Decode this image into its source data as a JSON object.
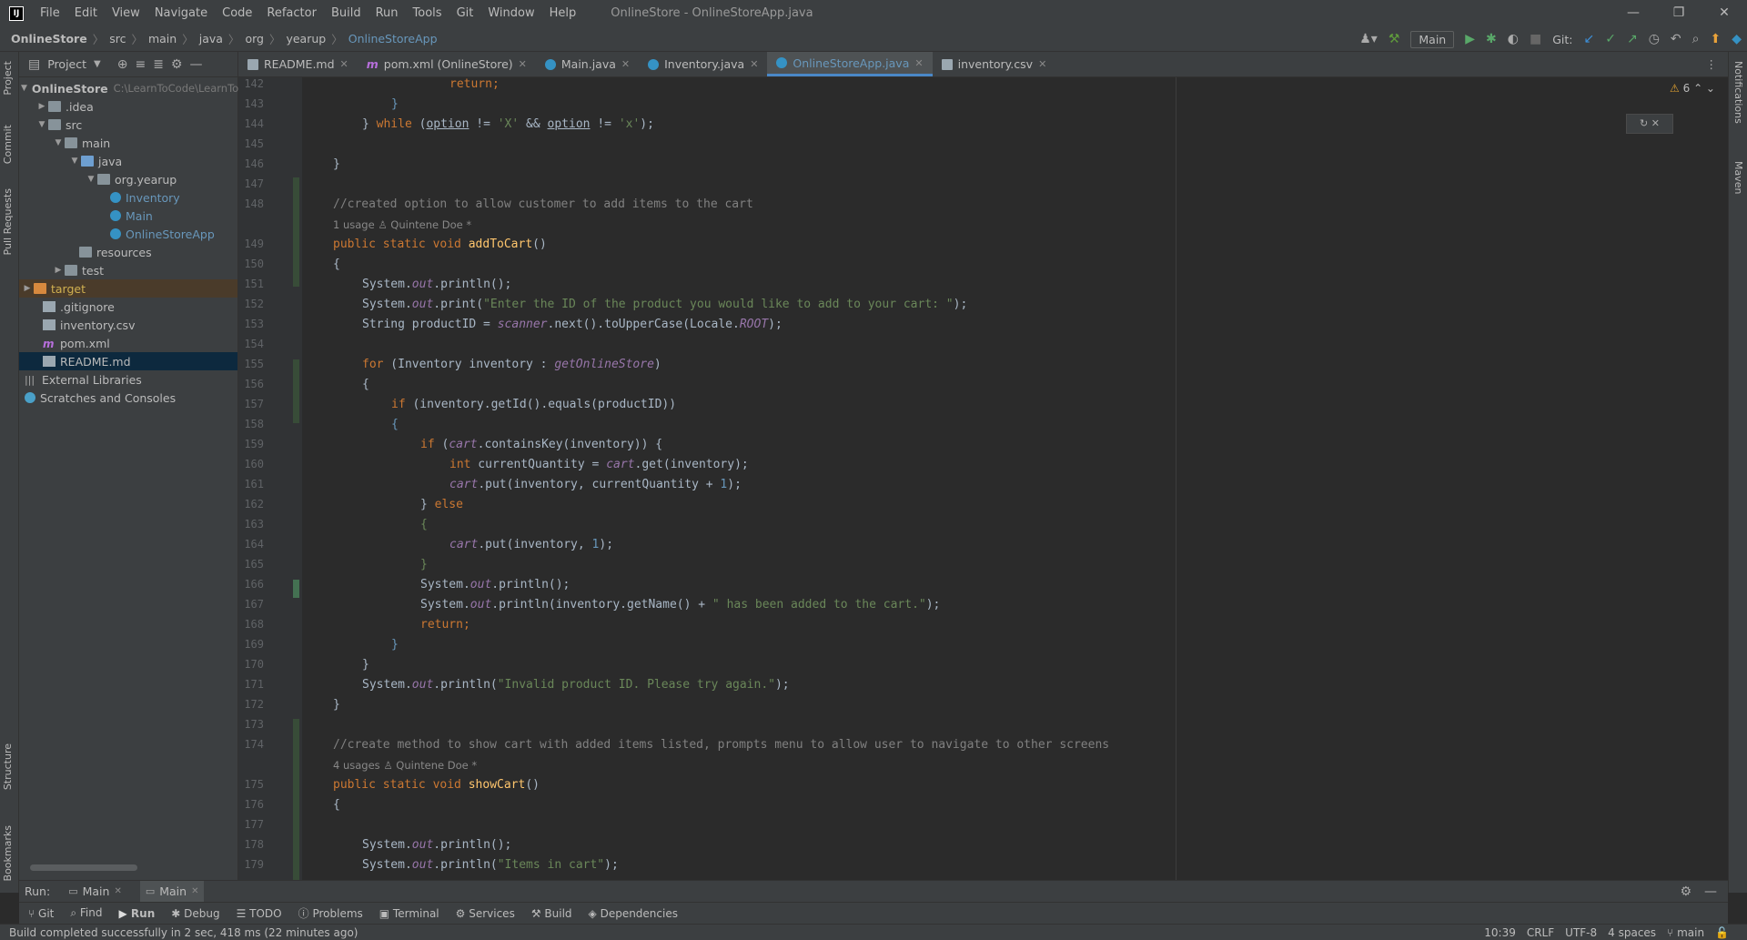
{
  "window": {
    "menu": [
      "File",
      "Edit",
      "View",
      "Navigate",
      "Code",
      "Refactor",
      "Build",
      "Run",
      "Tools",
      "Git",
      "Window",
      "Help"
    ],
    "title": "OnlineStore - OnlineStoreApp.java",
    "controls": [
      "—",
      "❐",
      "✕"
    ]
  },
  "breadcrumb": [
    "OnlineStore",
    "src",
    "main",
    "java",
    "org",
    "yearup",
    "OnlineStoreApp"
  ],
  "toolbar": {
    "run_config": "Main",
    "git_label": "Git:"
  },
  "left_stripe": [
    "Project",
    "Commit",
    "Pull Requests",
    "Structure",
    "Bookmarks"
  ],
  "right_stripe": [
    "Notifications",
    "Maven"
  ],
  "project": {
    "title": "Project",
    "root": {
      "name": "OnlineStore",
      "path": "C:\\LearnToCode\\LearnToC"
    },
    "items": [
      {
        "label": ".idea"
      },
      {
        "label": "src"
      },
      {
        "label": "main"
      },
      {
        "label": "java"
      },
      {
        "label": "org.yearup"
      },
      {
        "label": "Inventory"
      },
      {
        "label": "Main"
      },
      {
        "label": "OnlineStoreApp"
      },
      {
        "label": "resources"
      },
      {
        "label": "test"
      },
      {
        "label": "target"
      },
      {
        "label": ".gitignore"
      },
      {
        "label": "inventory.csv"
      },
      {
        "label": "pom.xml"
      },
      {
        "label": "README.md"
      },
      {
        "label": "External Libraries"
      },
      {
        "label": "Scratches and Consoles"
      }
    ]
  },
  "tabs": [
    {
      "label": "README.md"
    },
    {
      "label": "pom.xml (OnlineStore)"
    },
    {
      "label": "Main.java"
    },
    {
      "label": "Inventory.java"
    },
    {
      "label": "OnlineStoreApp.java"
    },
    {
      "label": "inventory.csv"
    }
  ],
  "editor": {
    "warnings": "6",
    "line_numbers": [
      "142",
      "143",
      "144",
      "145",
      "146",
      "147",
      "148",
      "149",
      "150",
      "151",
      "152",
      "153",
      "154",
      "155",
      "156",
      "157",
      "158",
      "159",
      "160",
      "161",
      "162",
      "163",
      "164",
      "165",
      "166",
      "167",
      "168",
      "169",
      "170",
      "171",
      "172",
      "173",
      "174",
      "175",
      "176",
      "177",
      "178",
      "179"
    ],
    "hint1": "1 usage   ♙ Quintene Doe *",
    "hint2": "4 usages   ♙ Quintene Doe *",
    "code": {
      "l142": "return;",
      "l144a": "} ",
      "l144kw": "while",
      "l144b": " (",
      "l144c": "option",
      "l144d": " != ",
      "l144e": "'X'",
      "l144f": " && ",
      "l144g": "option",
      "l144h": " != ",
      "l144i": "'x'",
      "l144j": ");",
      "l148": "//created option to allow customer to add items to the cart",
      "l149kw": "public static void ",
      "l149fn": "addToCart",
      "l149b": "()",
      "l152a": "System.",
      "l152b": "out",
      "l152c": ".print(",
      "l152d": "\"Enter the ID of the product you would like to add to your cart: \"",
      "l152e": ");",
      "l153a": "String productID = ",
      "l153b": "scanner",
      "l153c": ".next().toUpperCase(Locale.",
      "l153d": "ROOT",
      "l153e": ");",
      "l155kw": "for",
      "l155a": " (Inventory inventory : ",
      "l155b": "getOnlineStore",
      "l155c": ")",
      "l157kw": "if",
      "l157a": " (inventory.getId().equals(productID))",
      "l159kw": "if",
      "l159a": " (",
      "l159b": "cart",
      "l159c": ".containsKey(inventory)) {",
      "l160kw": "int",
      "l160a": " currentQuantity = ",
      "l160b": "cart",
      "l160c": ".get(inventory);",
      "l161a": "cart",
      "l161b": ".put(inventory, currentQuantity + ",
      "l161c": "1",
      "l161d": ");",
      "l162a": "} ",
      "l162kw": "else",
      "l164a": "cart",
      "l164b": ".put(inventory, ",
      "l164c": "1",
      "l164d": ");",
      "l166a": "System.",
      "l166b": "out",
      "l166c": ".println();",
      "l167a": "System.",
      "l167b": "out",
      "l167c": ".println(inventory.getName() + ",
      "l167d": "\" has been added to the cart.\"",
      "l167e": ");",
      "l168": "return;",
      "l171a": "System.",
      "l171b": "out",
      "l171c": ".println(",
      "l171d": "\"Invalid product ID. Please try again.\"",
      "l171e": ");",
      "l174": "//create method to show cart with added items listed, prompts menu to allow user to navigate to other screens",
      "l175kw": "public static void ",
      "l175fn": "showCart",
      "l175b": "()",
      "l178a": "System.",
      "l178b": "out",
      "l178c": ".println();",
      "l179a": "System.",
      "l179b": "out",
      "l179c": ".println(",
      "l179d": "\"Items in cart\"",
      "l179e": ");"
    }
  },
  "run": {
    "label": "Run:",
    "tabs": [
      "Main",
      "Main"
    ]
  },
  "bottom_tools": [
    "Git",
    "Find",
    "Run",
    "Debug",
    "TODO",
    "Problems",
    "Terminal",
    "Services",
    "Build",
    "Dependencies"
  ],
  "status": {
    "message": "Build completed successfully in 2 sec, 418 ms (22 minutes ago)",
    "position": "10:39",
    "line_sep": "CRLF",
    "encoding": "UTF-8",
    "indent": "4 spaces",
    "branch": "main"
  }
}
